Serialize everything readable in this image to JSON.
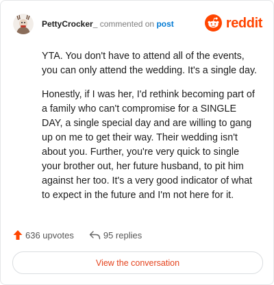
{
  "comment": {
    "username": "PettyCrocker_",
    "action_text": "commented on",
    "post_link": "post",
    "paragraphs": [
      "YTA. You don't have to attend all of the events, you can only attend the wedding. It's a single day.",
      "Honestly, if I was her, I'd rethink becoming part of a family who can't compromise for a SINGLE DAY, a single special day and are willing to gang up on me to get their way. Their wedding isn't about you. Further, you're very quick to single your brother out, her future husband, to pit him against her too. It's a very good indicator of what to expect in the future and I'm not here for it."
    ]
  },
  "brand": {
    "logo_text": "reddit",
    "icon": "reddit-snoo-icon",
    "color": "#ff4500"
  },
  "stats": {
    "upvotes_label": "636 upvotes",
    "replies_label": "95 replies",
    "upvote_icon": "upvote-arrow-icon",
    "reply_icon": "reply-arrow-icon",
    "upvote_color": "#ff4500"
  },
  "cta": {
    "label": "View the conversation",
    "color": "#e4421c"
  }
}
